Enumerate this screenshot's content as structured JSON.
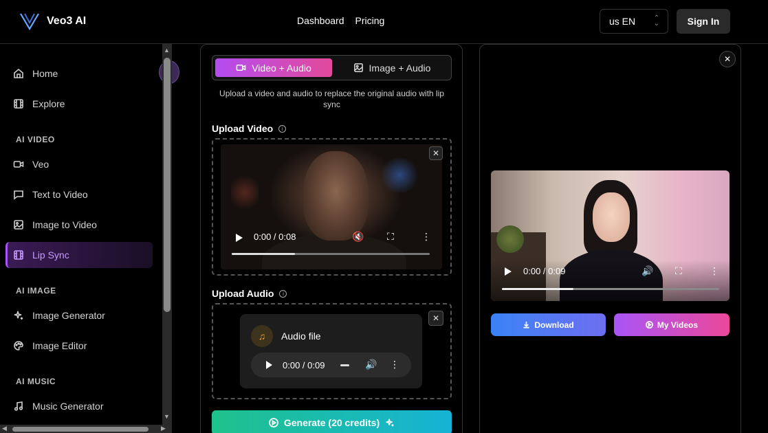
{
  "header": {
    "app_name": "Veo3 AI",
    "nav": [
      "Dashboard",
      "Pricing"
    ],
    "language": "us EN",
    "sign_in": "Sign In"
  },
  "sidebar": {
    "items": [
      {
        "label": "Home",
        "icon": "home-icon"
      },
      {
        "label": "Explore",
        "icon": "film-icon"
      }
    ],
    "sections": [
      {
        "title": "AI VIDEO",
        "items": [
          {
            "label": "Veo",
            "icon": "video-icon"
          },
          {
            "label": "Text to Video",
            "icon": "message-icon"
          },
          {
            "label": "Image to Video",
            "icon": "image-icon"
          },
          {
            "label": "Lip Sync",
            "icon": "film-icon",
            "active": true
          }
        ]
      },
      {
        "title": "AI IMAGE",
        "items": [
          {
            "label": "Image Generator",
            "icon": "sparkles-icon"
          },
          {
            "label": "Image Editor",
            "icon": "palette-icon"
          }
        ]
      },
      {
        "title": "AI MUSIC",
        "items": [
          {
            "label": "Music Generator",
            "icon": "music-icon"
          }
        ]
      }
    ]
  },
  "editor": {
    "tabs": [
      {
        "label": "Video + Audio",
        "active": true
      },
      {
        "label": "Image + Audio",
        "active": false
      }
    ],
    "helper_text": "Upload a video and audio to replace the original audio with lip sync",
    "upload_video_label": "Upload Video",
    "video_time": "0:00 / 0:08",
    "video_progress": 0.32,
    "upload_audio_label": "Upload Audio",
    "audio_title": "Audio file",
    "audio_time": "0:00 / 0:09",
    "generate_label": "Generate (20 credits)"
  },
  "result": {
    "video_time": "0:00 / 0:09",
    "video_progress": 0.33,
    "download_label": "Download",
    "my_videos_label": "My Videos"
  },
  "colors": {
    "accent_purple": "#a855f7",
    "accent_pink": "#ec4899",
    "generate_green": "#1ec28b",
    "download_blue": "#3b82f6"
  }
}
